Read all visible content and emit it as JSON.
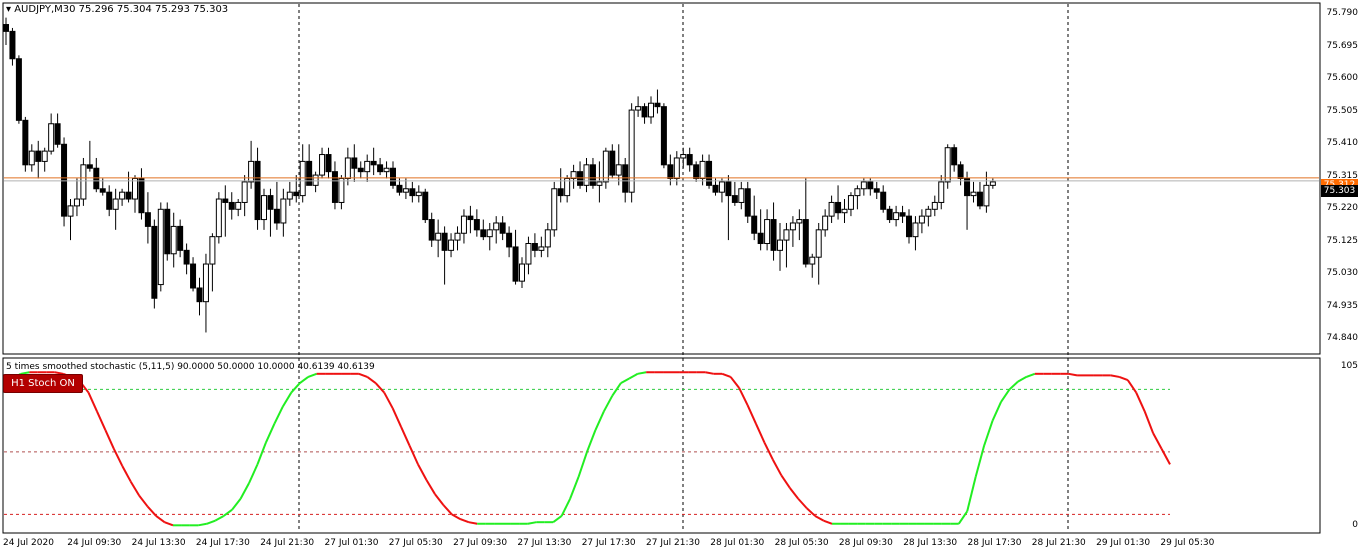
{
  "main_panel": {
    "title": "AUDJPY,M30",
    "ohlc": "75.296 75.304 75.293 75.303",
    "price_axis": [
      "75.790",
      "75.695",
      "75.600",
      "75.505",
      "75.410",
      "75.315",
      "75.220",
      "75.125",
      "75.030",
      "74.935",
      "74.840"
    ],
    "current_price": "75.303",
    "line_price": "75.312"
  },
  "indicator_panel": {
    "label": "5 times smoothed stochastic (5,11,5) 90.0000 50.0000 10.0000 40.6139 40.6139",
    "button_label": "H1 Stoch ON",
    "axis_top": "105",
    "axis_bottom": "0"
  },
  "time_axis": [
    "24 Jul 2020",
    "24 Jul 09:30",
    "24 Jul 13:30",
    "24 Jul 17:30",
    "24 Jul 21:30",
    "27 Jul 01:30",
    "27 Jul 05:30",
    "27 Jul 09:30",
    "27 Jul 13:30",
    "27 Jul 17:30",
    "27 Jul 21:30",
    "28 Jul 01:30",
    "28 Jul 05:30",
    "28 Jul 09:30",
    "28 Jul 13:30",
    "28 Jul 17:30",
    "28 Jul 21:30",
    "29 Jul 01:30",
    "29 Jul 05:30"
  ],
  "chart_data": {
    "type": "candlestick",
    "candles": [
      [
        75.76,
        75.78,
        75.7,
        75.74
      ],
      [
        75.74,
        75.75,
        75.64,
        75.66
      ],
      [
        75.66,
        75.67,
        75.47,
        75.48
      ],
      [
        75.48,
        75.49,
        75.33,
        75.35
      ],
      [
        75.35,
        75.41,
        75.33,
        75.39
      ],
      [
        75.39,
        75.42,
        75.31,
        75.36
      ],
      [
        75.36,
        75.4,
        75.33,
        75.39
      ],
      [
        75.39,
        75.5,
        75.38,
        75.47
      ],
      [
        75.47,
        75.5,
        75.4,
        75.41
      ],
      [
        75.41,
        75.43,
        75.17,
        75.2
      ],
      [
        75.2,
        75.25,
        75.13,
        75.23
      ],
      [
        75.23,
        75.31,
        75.2,
        75.25
      ],
      [
        75.25,
        75.37,
        75.23,
        75.35
      ],
      [
        75.35,
        75.42,
        75.33,
        75.34
      ],
      [
        75.34,
        75.37,
        75.27,
        75.28
      ],
      [
        75.28,
        75.31,
        75.26,
        75.27
      ],
      [
        75.27,
        75.29,
        75.2,
        75.22
      ],
      [
        75.22,
        75.28,
        75.16,
        75.25
      ],
      [
        75.25,
        75.28,
        75.23,
        75.27
      ],
      [
        75.27,
        75.33,
        75.24,
        75.25
      ],
      [
        75.25,
        75.32,
        75.21,
        75.31
      ],
      [
        75.31,
        75.34,
        75.19,
        75.21
      ],
      [
        75.21,
        75.27,
        75.12,
        75.17
      ],
      [
        75.17,
        75.19,
        74.93,
        74.96
      ],
      [
        75.0,
        75.24,
        74.98,
        75.22
      ],
      [
        75.22,
        75.24,
        75.07,
        75.09
      ],
      [
        75.09,
        75.21,
        75.05,
        75.17
      ],
      [
        75.17,
        75.19,
        75.08,
        75.1
      ],
      [
        75.1,
        75.12,
        75.03,
        75.06
      ],
      [
        75.06,
        75.08,
        74.98,
        74.99
      ],
      [
        74.99,
        75.02,
        74.91,
        74.95
      ],
      [
        74.95,
        75.09,
        74.86,
        75.06
      ],
      [
        75.06,
        75.15,
        74.98,
        75.14
      ],
      [
        75.14,
        75.27,
        75.12,
        75.25
      ],
      [
        75.25,
        75.29,
        75.14,
        75.24
      ],
      [
        75.24,
        75.27,
        75.19,
        75.22
      ],
      [
        75.22,
        75.25,
        75.2,
        75.24
      ],
      [
        75.24,
        75.32,
        75.2,
        75.3
      ],
      [
        75.3,
        75.42,
        75.28,
        75.36
      ],
      [
        75.36,
        75.4,
        75.16,
        75.19
      ],
      [
        75.19,
        75.28,
        75.16,
        75.26
      ],
      [
        75.26,
        75.28,
        75.14,
        75.22
      ],
      [
        75.22,
        75.3,
        75.16,
        75.18
      ],
      [
        75.18,
        75.28,
        75.14,
        75.25
      ],
      [
        75.25,
        75.3,
        75.23,
        75.27
      ],
      [
        75.27,
        75.32,
        75.24,
        75.26
      ],
      [
        75.26,
        75.41,
        75.24,
        75.36
      ],
      [
        75.36,
        75.41,
        75.29,
        75.29
      ],
      [
        75.29,
        75.33,
        75.27,
        75.32
      ],
      [
        75.32,
        75.4,
        75.31,
        75.38
      ],
      [
        75.38,
        75.4,
        75.31,
        75.33
      ],
      [
        75.33,
        75.36,
        75.22,
        75.24
      ],
      [
        75.24,
        75.32,
        75.22,
        75.31
      ],
      [
        75.31,
        75.4,
        75.29,
        75.37
      ],
      [
        75.37,
        75.41,
        75.3,
        75.34
      ],
      [
        75.34,
        75.36,
        75.31,
        75.33
      ],
      [
        75.33,
        75.38,
        75.3,
        75.36
      ],
      [
        75.36,
        75.4,
        75.32,
        75.35
      ],
      [
        75.35,
        75.37,
        75.32,
        75.33
      ],
      [
        75.33,
        75.36,
        75.31,
        75.34
      ],
      [
        75.34,
        75.36,
        75.28,
        75.29
      ],
      [
        75.29,
        75.31,
        75.26,
        75.27
      ],
      [
        75.27,
        75.31,
        75.25,
        75.28
      ],
      [
        75.28,
        75.3,
        75.24,
        75.26
      ],
      [
        75.26,
        75.29,
        75.24,
        75.27
      ],
      [
        75.27,
        75.28,
        75.18,
        75.19
      ],
      [
        75.19,
        75.21,
        75.11,
        75.13
      ],
      [
        75.13,
        75.19,
        75.08,
        75.15
      ],
      [
        75.15,
        75.17,
        75.0,
        75.1
      ],
      [
        75.1,
        75.15,
        75.08,
        75.13
      ],
      [
        75.13,
        75.17,
        75.1,
        75.15
      ],
      [
        75.15,
        75.22,
        75.12,
        75.2
      ],
      [
        75.2,
        75.23,
        75.15,
        75.19
      ],
      [
        75.19,
        75.22,
        75.14,
        75.16
      ],
      [
        75.16,
        75.19,
        75.13,
        75.14
      ],
      [
        75.14,
        75.18,
        75.1,
        75.16
      ],
      [
        75.16,
        75.2,
        75.12,
        75.18
      ],
      [
        75.18,
        75.2,
        75.13,
        75.15
      ],
      [
        75.15,
        75.17,
        75.08,
        75.11
      ],
      [
        75.11,
        75.16,
        75.0,
        75.01
      ],
      [
        75.01,
        75.08,
        74.99,
        75.06
      ],
      [
        75.06,
        75.14,
        75.03,
        75.12
      ],
      [
        75.12,
        75.15,
        75.08,
        75.1
      ],
      [
        75.1,
        75.14,
        75.08,
        75.11
      ],
      [
        75.11,
        75.18,
        75.08,
        75.16
      ],
      [
        75.16,
        75.3,
        75.14,
        75.28
      ],
      [
        75.28,
        75.34,
        75.24,
        75.26
      ],
      [
        75.26,
        75.32,
        75.24,
        75.31
      ],
      [
        75.31,
        75.35,
        75.28,
        75.33
      ],
      [
        75.33,
        75.36,
        75.28,
        75.29
      ],
      [
        75.29,
        75.37,
        75.27,
        75.35
      ],
      [
        75.35,
        75.37,
        75.28,
        75.29
      ],
      [
        75.29,
        75.36,
        75.24,
        75.3
      ],
      [
        75.3,
        75.4,
        75.28,
        75.39
      ],
      [
        75.39,
        75.41,
        75.31,
        75.32
      ],
      [
        75.32,
        75.41,
        75.29,
        75.35
      ],
      [
        75.35,
        75.37,
        75.24,
        75.27
      ],
      [
        75.27,
        75.53,
        75.24,
        75.51
      ],
      [
        75.51,
        75.55,
        75.49,
        75.52
      ],
      [
        75.52,
        75.53,
        75.47,
        75.49
      ],
      [
        75.49,
        75.55,
        75.47,
        75.53
      ],
      [
        75.53,
        75.57,
        75.5,
        75.52
      ],
      [
        75.52,
        75.53,
        75.34,
        75.35
      ],
      [
        75.35,
        75.38,
        75.29,
        75.31
      ],
      [
        75.31,
        75.39,
        75.29,
        75.37
      ],
      [
        75.37,
        75.4,
        75.34,
        75.38
      ],
      [
        75.38,
        75.4,
        75.33,
        75.35
      ],
      [
        75.35,
        75.36,
        75.3,
        75.31
      ],
      [
        75.31,
        75.38,
        75.29,
        75.36
      ],
      [
        75.36,
        75.38,
        75.28,
        75.29
      ],
      [
        75.29,
        75.31,
        75.26,
        75.27
      ],
      [
        75.27,
        75.31,
        75.24,
        75.3
      ],
      [
        75.3,
        75.32,
        75.13,
        75.26
      ],
      [
        75.26,
        75.3,
        75.23,
        75.24
      ],
      [
        75.24,
        75.3,
        75.22,
        75.28
      ],
      [
        75.28,
        75.3,
        75.18,
        75.2
      ],
      [
        75.2,
        75.26,
        75.13,
        75.15
      ],
      [
        75.15,
        75.22,
        75.1,
        75.12
      ],
      [
        75.12,
        75.22,
        75.1,
        75.19
      ],
      [
        75.19,
        75.24,
        75.07,
        75.1
      ],
      [
        75.1,
        75.18,
        75.04,
        75.13
      ],
      [
        75.13,
        75.18,
        75.05,
        75.16
      ],
      [
        75.16,
        75.2,
        75.11,
        75.18
      ],
      [
        75.18,
        75.22,
        75.13,
        75.19
      ],
      [
        75.19,
        75.31,
        75.05,
        75.06
      ],
      [
        75.06,
        75.09,
        75.02,
        75.08
      ],
      [
        75.08,
        75.18,
        75.0,
        75.16
      ],
      [
        75.16,
        75.22,
        75.14,
        75.2
      ],
      [
        75.2,
        75.26,
        75.18,
        75.24
      ],
      [
        75.24,
        75.29,
        75.19,
        75.21
      ],
      [
        75.21,
        75.25,
        75.18,
        75.22
      ],
      [
        75.22,
        75.27,
        75.2,
        75.26
      ],
      [
        75.26,
        75.29,
        75.22,
        75.28
      ],
      [
        75.28,
        75.31,
        75.26,
        75.3
      ],
      [
        75.3,
        75.31,
        75.26,
        75.28
      ],
      [
        75.28,
        75.3,
        75.25,
        75.27
      ],
      [
        75.27,
        75.29,
        75.21,
        75.22
      ],
      [
        75.22,
        75.23,
        75.18,
        75.19
      ],
      [
        75.19,
        75.23,
        75.17,
        75.21
      ],
      [
        75.21,
        75.23,
        75.18,
        75.2
      ],
      [
        75.2,
        75.22,
        75.12,
        75.14
      ],
      [
        75.14,
        75.2,
        75.1,
        75.18
      ],
      [
        75.18,
        75.22,
        75.15,
        75.2
      ],
      [
        75.2,
        75.23,
        75.17,
        75.22
      ],
      [
        75.22,
        75.26,
        75.2,
        75.24
      ],
      [
        75.24,
        75.32,
        75.22,
        75.3
      ],
      [
        75.3,
        75.41,
        75.28,
        75.4
      ],
      [
        75.4,
        75.41,
        75.33,
        75.35
      ],
      [
        75.35,
        75.36,
        75.29,
        75.31
      ],
      [
        75.31,
        75.33,
        75.16,
        75.26
      ],
      [
        75.26,
        75.3,
        75.24,
        75.27
      ],
      [
        75.27,
        75.3,
        75.22,
        75.23
      ],
      [
        75.23,
        75.33,
        75.21,
        75.29
      ],
      [
        75.29,
        75.31,
        75.28,
        75.3
      ]
    ],
    "price_range": [
      74.8,
      75.82
    ],
    "current_price_line": 75.303,
    "orange_price_line": 75.312,
    "stochastic": {
      "levels": [
        90,
        50,
        10
      ],
      "range": [
        0,
        105
      ],
      "values": [
        93,
        97,
        100,
        101,
        101,
        101,
        101,
        100,
        98,
        95,
        88,
        76,
        64,
        52,
        41,
        31,
        22,
        15,
        9,
        5,
        3,
        3,
        3,
        3,
        4,
        6,
        9,
        13,
        20,
        30,
        42,
        56,
        68,
        79,
        88,
        94,
        98,
        100,
        100,
        100,
        100,
        100,
        100,
        98,
        94,
        88,
        78,
        66,
        54,
        42,
        32,
        23,
        16,
        10,
        7,
        5,
        4,
        4,
        4,
        4,
        4,
        4,
        4,
        5,
        5,
        5,
        9,
        20,
        34,
        50,
        64,
        76,
        86,
        94,
        97,
        100,
        101,
        101,
        101,
        101,
        101,
        101,
        101,
        101,
        100,
        100,
        98,
        91,
        80,
        68,
        56,
        45,
        35,
        27,
        20,
        14,
        9,
        6,
        4,
        4,
        4,
        4,
        4,
        4,
        4,
        4,
        4,
        4,
        4,
        4,
        4,
        4,
        4,
        4,
        12,
        34,
        54,
        70,
        82,
        90,
        95,
        98,
        100,
        100,
        100,
        100,
        100,
        99,
        99,
        99,
        99,
        99,
        98,
        96,
        88,
        76,
        62,
        52,
        42
      ]
    }
  }
}
